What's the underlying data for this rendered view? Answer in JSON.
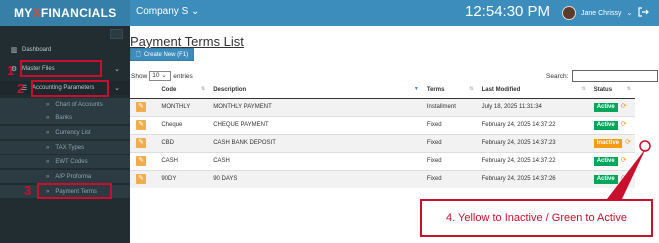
{
  "header": {
    "logo": {
      "prefix": "MY",
      "x": "X",
      "suffix": "FINANCIALS"
    },
    "company": "Company S",
    "company_chevron": "⌄",
    "time": "12:54:30 PM",
    "user_name": "Jane Chrissy",
    "user_chevron": "⌄"
  },
  "sidebar": {
    "dashboard": "Dashboard",
    "master_files": "Master Files",
    "accounting_parameters": "Accounting Parameters",
    "sub_items": [
      "Chart of Accounts",
      "Banks",
      "Currency List",
      "TAX Types",
      "EWT Codes",
      "A/P Proforma",
      "Payment Terms"
    ]
  },
  "annotations": {
    "step1": "1",
    "step2": "2",
    "step3": "3",
    "note": "4. Yellow to Inactive / Green to Active",
    "color": "#c8102e"
  },
  "main": {
    "title": "Payment Terms List",
    "create_button": "Create New (F1)",
    "show_label": "Show",
    "show_value": "10",
    "entries_label": "entries",
    "search_label": "Search:",
    "columns": [
      "",
      "Code",
      "Description",
      "Terms",
      "Last Modified",
      "Status"
    ],
    "rows": [
      {
        "code": "MONTHLY",
        "description": "MONTHLY PAYMENT",
        "terms": "Installment",
        "modified": "July 18, 2025 11:31:34",
        "status": "Active"
      },
      {
        "code": "Cheque",
        "description": "CHEQUE PAYMENT",
        "terms": "Fixed",
        "modified": "February 24, 2025 14:37:22",
        "status": "Active"
      },
      {
        "code": "CBD",
        "description": "CASH BANK DEPOSIT",
        "terms": "Fixed",
        "modified": "February 24, 2025 14:37:23",
        "status": "Inactive"
      },
      {
        "code": "CASH",
        "description": "CASH",
        "terms": "Fixed",
        "modified": "February 24, 2025 14:37:22",
        "status": "Active"
      },
      {
        "code": "90DY",
        "description": "90 DAYS",
        "terms": "Fixed",
        "modified": "February 24, 2025 14:37:26",
        "status": "Active"
      }
    ],
    "colors": {
      "active": "#00a65a",
      "inactive": "#f39c12",
      "primary": "#3c8dbc"
    }
  }
}
